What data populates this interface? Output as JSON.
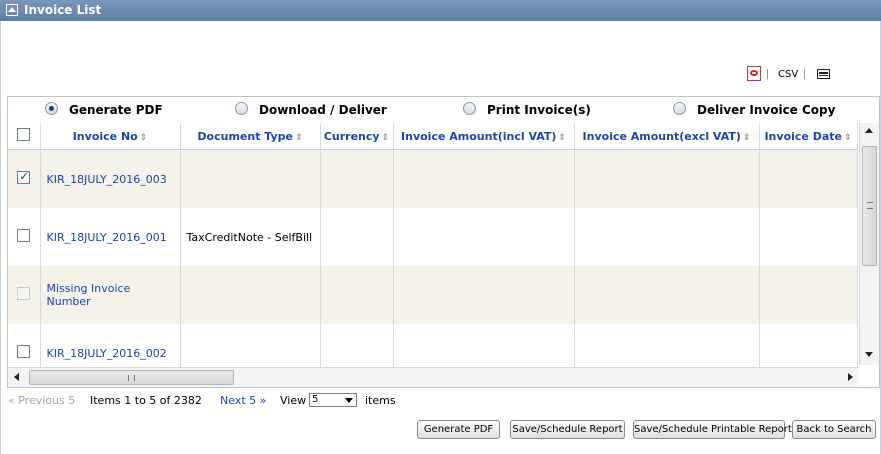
{
  "panel": {
    "title": "Invoice List"
  },
  "export": {
    "pdf_icon": "pdf-icon",
    "csv_label": "CSV",
    "print_icon": "printer-icon"
  },
  "radios": [
    {
      "label": "Generate PDF",
      "checked": true
    },
    {
      "label": "Download / Deliver",
      "checked": false
    },
    {
      "label": "Print Invoice(s)",
      "checked": false
    },
    {
      "label": "Deliver Invoice Copy",
      "checked": false
    }
  ],
  "table": {
    "columns": [
      "Invoice No",
      "Document Type",
      "Currency",
      "Invoice Amount(incl VAT)",
      "Invoice Amount(excl VAT)",
      "Invoice Date"
    ],
    "rows": [
      {
        "checked": true,
        "disabled": false,
        "invoice_no": "KIR_18JULY_2016_003",
        "doc_type": "",
        "currency": "",
        "amount_incl": "",
        "amount_excl": "",
        "date": ""
      },
      {
        "checked": false,
        "disabled": false,
        "invoice_no": "KIR_18JULY_2016_001",
        "doc_type": "TaxCreditNote - SelfBill",
        "currency": "",
        "amount_incl": "",
        "amount_excl": "",
        "date": ""
      },
      {
        "checked": false,
        "disabled": true,
        "invoice_no": "Missing Invoice Number",
        "doc_type": "",
        "currency": "",
        "amount_incl": "",
        "amount_excl": "",
        "date": ""
      },
      {
        "checked": false,
        "disabled": false,
        "invoice_no": "KIR_18JULY_2016_002",
        "doc_type": "",
        "currency": "",
        "amount_incl": "",
        "amount_excl": "",
        "date": ""
      }
    ]
  },
  "pager": {
    "prev": "« Previous 5",
    "info": "Items 1 to 5 of 2382",
    "next": "Next 5 »",
    "view_label": "View",
    "view_value": "5",
    "items_label": "items"
  },
  "buttons": {
    "generate_pdf": "Generate PDF",
    "save_schedule": "Save/Schedule Report",
    "save_schedule_printable": "Save/Schedule Printable Report",
    "back": "Back to Search"
  }
}
